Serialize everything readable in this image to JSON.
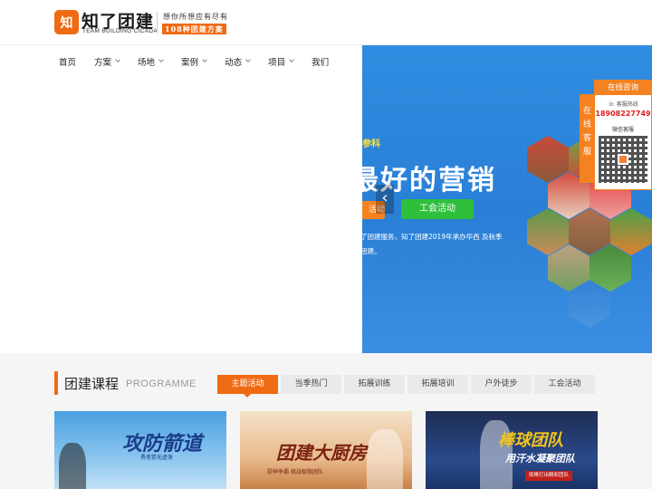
{
  "header": {
    "logo_mark": "知",
    "brand_name": "知了团建",
    "brand_en": "TEAM BUILDING CICADA",
    "slogan": "想你所想应有尽有",
    "slogan_badge": "108种团建方案"
  },
  "nav": {
    "items": [
      {
        "label": "首页",
        "has_dropdown": false
      },
      {
        "label": "方案",
        "has_dropdown": true
      },
      {
        "label": "场地",
        "has_dropdown": true
      },
      {
        "label": "案例",
        "has_dropdown": true
      },
      {
        "label": "动态",
        "has_dropdown": true
      },
      {
        "label": "项目",
        "has_dropdown": true
      },
      {
        "label": "我们",
        "has_dropdown": false
      }
    ]
  },
  "banner": {
    "subtitle": "参科",
    "title": "最好的营销",
    "left_button": "活动",
    "button": "工会活动",
    "description": "了团建服务，知了团建2019年承办华西 及秋季团建。",
    "prev_arrow": "‹"
  },
  "float": {
    "tab": "在线客服",
    "head": "在线咨询",
    "hotline_label": "客服热线",
    "hotline": "18908227749",
    "wechat_label": "微信客服"
  },
  "section": {
    "title": "团建课程",
    "title_en": "PROGRAMME",
    "tabs": [
      {
        "label": "主题活动",
        "active": true
      },
      {
        "label": "当季热门",
        "active": false
      },
      {
        "label": "拓展训练",
        "active": false
      },
      {
        "label": "拓展培训",
        "active": false
      },
      {
        "label": "户外徒步",
        "active": false
      },
      {
        "label": "工会活动",
        "active": false
      }
    ],
    "cards": [
      {
        "title": "攻防箭道",
        "sub": "勇者箭无虚发"
      },
      {
        "title": "团建大厨房",
        "sub": "厨神争霸 挑战极限团队"
      },
      {
        "title": "棒球团队",
        "sub": "用汗水凝聚团队",
        "badge": "挥棒打出精彩团队"
      }
    ]
  },
  "colors": {
    "accent": "#f06a14",
    "banner_blue": "#2f8de0",
    "green_button": "#2fbf3d",
    "hotline_red": "#e02020"
  }
}
